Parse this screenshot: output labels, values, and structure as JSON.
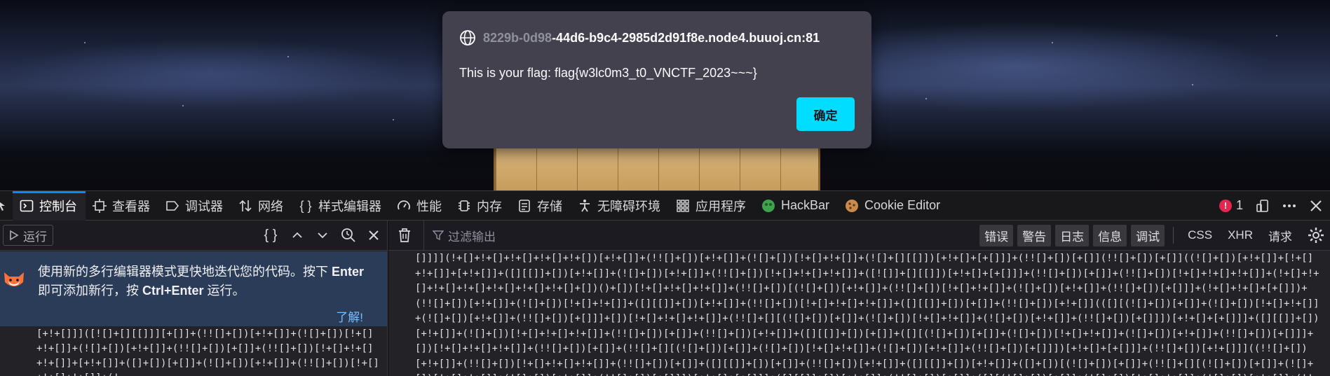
{
  "dialog": {
    "origin_faded": "8229b-0d98",
    "origin_rest": "-44d6-b9c4-2985d2d91f8e.node4.buuoj.cn:81",
    "message": "This is your flag: flag{w3lc0m3_t0_VNCTF_2023~~~}",
    "ok_label": "确定"
  },
  "devtools": {
    "tabs": [
      {
        "label": "控制台",
        "icon": "console-icon",
        "active": true
      },
      {
        "label": "查看器",
        "icon": "inspector-icon"
      },
      {
        "label": "调试器",
        "icon": "debugger-icon"
      },
      {
        "label": "网络",
        "icon": "network-icon"
      },
      {
        "label": "样式编辑器",
        "icon": "style-editor-icon"
      },
      {
        "label": "性能",
        "icon": "performance-icon"
      },
      {
        "label": "内存",
        "icon": "memory-icon"
      },
      {
        "label": "存储",
        "icon": "storage-icon"
      },
      {
        "label": "无障碍环境",
        "icon": "accessibility-icon"
      },
      {
        "label": "应用程序",
        "icon": "application-icon"
      },
      {
        "label": "HackBar",
        "icon": "hackbar-icon"
      },
      {
        "label": "Cookie Editor",
        "icon": "cookie-icon"
      }
    ],
    "error_count": "1",
    "accent": "#0a84ff"
  },
  "left_pane": {
    "run_label": "运行",
    "notice_line1_pre": "使用新的多行编辑器模式更快地迭代您的代码。按下 ",
    "notice_line1_key": "Enter",
    "notice_line2_pre": "即可添加新行，按 ",
    "notice_line2_key": "Ctrl+Enter",
    "notice_line2_post": " 运行。",
    "notice_link": "了解!",
    "code_text": "[+!+[]]]([![]+[][[]]][+[]]+(!![]+[])[+!+[]]+(![]+[])[!+[]+!+[]]+(![]+[])[+!+[]]+(!![]+[])[+[]]+(!![]+[])[!+[]+!+[]+!+[]]+[+!+[]]+([]+[])[+[]]+(![]+[])[+!+[]]+(!![]+[])[!+[]+!+[]+!+[]]+(!"
  },
  "right_pane": {
    "filter_placeholder": "过滤输出",
    "filters": [
      "错误",
      "警告",
      "日志",
      "信息",
      "调试"
    ],
    "extra_filters": [
      "CSS",
      "XHR",
      "请求"
    ],
    "output_text": "[]]]](!+[]+!+[]+!+[]+!+[]+!+[])[+!+[]]+(!![]+[])[+!+[]]+(![]+[])[!+[]+!+[]]+(![]+[][[]])[+!+[]+[+[]]]+(!![]+[])[+[]](!![]+[])[+[]]((![]+[])[+!+[]]+[!+[]+!+[]]+[+!+[]]+([][[]]+[])[+!+[]]+(![]+[])[+!+[]]+(!![]+[])[!+[]+!+[]+!+[]]+([![]]+[][[]])[+!+[]+[+[]]]+(!![]+[])[+[]]+(!![]+[])[!+[]+!+[]+!+[]]+(!+[]+!+[]+!+[]+!+[]+!+[]+!+[]+!+[]+[])()+[])[!+[]+!+[]+!+[]]+(!![]+[])[(![]+[])[+!+[]]+(!![]+[])[!+[]+!+[]]+(![]+[])[+!+[]]+(!![]+[])[+[]]]+(!+[]+!+[]+[+[]])+(!![]+[])[+!+[]]+(![]+[])[!+[]+!+[]]+([][[]]+[])[+!+[]]+(!![]+[])[!+[]+!+[]+!+[]]+([][[]]+[])[+[]]+(!![]+[])[+!+[]](([][(![]+[])[+[]]+(![]+[])[!+[]+!+[]]+(![]+[])[+!+[]]+(!![]+[])[+[]]]+[])[!+[]+!+[]+!+[]]+(!![]+[][(![]+[])[+[]]+(![]+[])[!+[]+!+[]]+(![]+[])[+!+[]]+(!![]+[])[+[]]])[+!+[]+[+[]]]+([][[]]+[])[+!+[]]+(![]+[])[!+[]+!+[]+!+[]]+(!![]+[])[+[]]+(!![]+[])[+!+[]]+([][[]]+[])[+[]]+([][(![]+[])[+[]]+(![]+[])[!+[]+!+[]]+(![]+[])[+!+[]]+(!![]+[])[+[]]]+[])[!+[]+!+[]+!+[]]+(!![]+[])[+[]]+(!![]+[][(![]+[])[+[]]+(![]+[])[!+[]+!+[]]+(![]+[])[+!+[]]+(!![]+[])[+[]]])[+!+[]+[+[]]]+(!![]+[])[+!+[]]]((!![]+[])[+!+[]]+(!![]+[])[!+[]+!+[]+!+[]]+(!![]+[])[+[]]+([][[]]+[])[+[]]+(!![]+[])[+!+[]]+([][[]]+[])[+!+[]]+([]+[])[(![]+[])[+[]]+(!![]+[][(![]+[])[+[]]+(![]+[])[!+[]+!+[]]+(![]+[])[+!+[]]+(!![]+[])[+[]]])[+!+[]+[+[]]]+([][[]]+[])[+!+[]]+(!![]+[])[+[]]+([][(![]+[])[+[]]+(![]+[])[!+[]+!+[]]+(![]+[])[+!+[]]+(!![]+[])[+[]]]+[])[!+[]+!+[]+!+[]]+(!![]+[][(![]+[])[+[]]+(![]+[])[!+[]+!+[]]+(![]+[])[+!+[]]+(!![]+[])[+[]]])[+!+[]+[+[]]]+(![]+[])[!+[]+!+[]]+(!![]+[][(![]+[])[+[]]+(![]+[])[!+[]+!+[]]+(![]+[])[+!+[]]+(!![]+[])[+[]]])[+!+[]+[+[]]]+(!![]+[])[+!+[]]]()[+!+[]+[!+[]+!+[]]]+(!+[]+!+[]+[+[]])"
  }
}
